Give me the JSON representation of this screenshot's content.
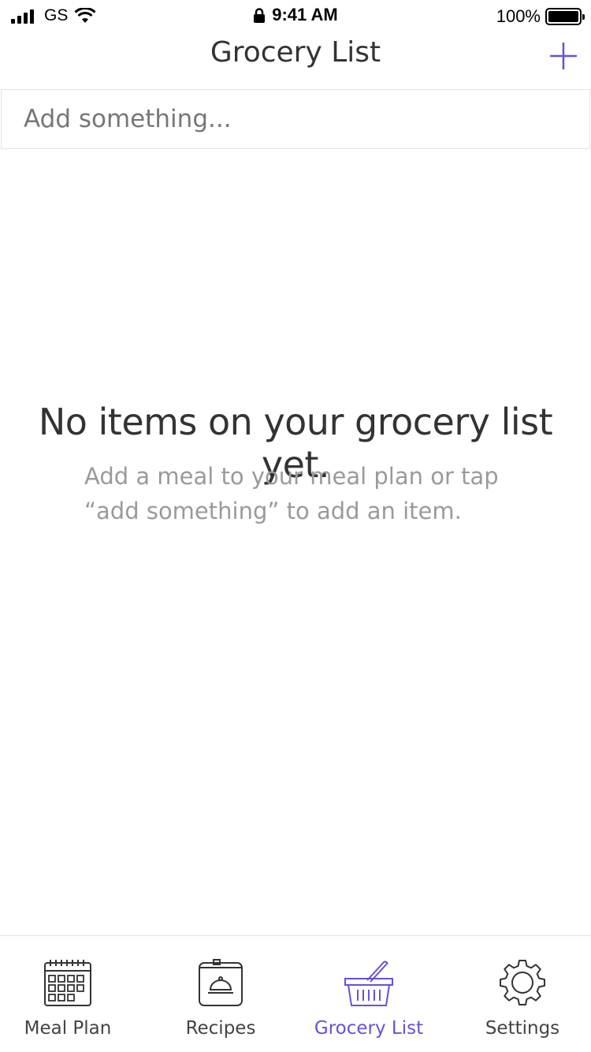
{
  "status_bar": {
    "carrier": "GS",
    "time": "9:41 AM",
    "battery": "100%"
  },
  "nav": {
    "title": "Grocery List",
    "add_icon": "plus-icon"
  },
  "add_bar": {
    "placeholder": "Add something..."
  },
  "empty_state": {
    "title": "No items on your grocery list yet.",
    "subtitle": "Add a meal to your meal plan or tap “add something” to add an item."
  },
  "tabs": [
    {
      "label": "Meal Plan",
      "icon": "calendar-icon",
      "active": false
    },
    {
      "label": "Recipes",
      "icon": "recipe-book-icon",
      "active": false
    },
    {
      "label": "Grocery List",
      "icon": "basket-icon",
      "active": true
    },
    {
      "label": "Settings",
      "icon": "gear-icon",
      "active": false
    }
  ],
  "colors": {
    "accent": "#6a4fd6",
    "text": "#333333",
    "muted": "#9a9a9a",
    "divider": "#e3e3e3"
  }
}
